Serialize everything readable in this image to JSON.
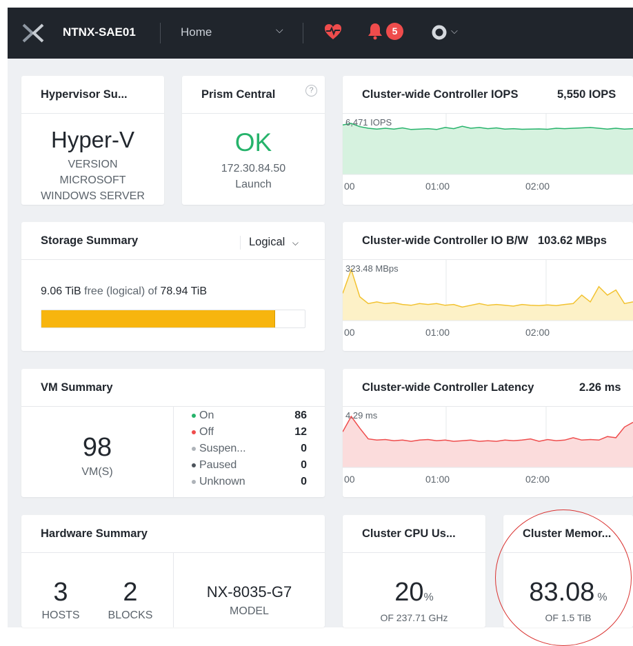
{
  "topbar": {
    "cluster_name": "NTNX-SAE01",
    "view": "Home",
    "alerts_count": "5"
  },
  "hypervisor": {
    "title": "Hypervisor Su...",
    "name": "Hyper-V",
    "version_label": "VERSION",
    "version_line1": "MICROSOFT",
    "version_line2": "WINDOWS SERVER"
  },
  "prism_central": {
    "title": "Prism Central",
    "help": "?",
    "status": "OK",
    "ip": "172.30.84.50",
    "link": "Launch"
  },
  "storage": {
    "title": "Storage Summary",
    "view_select": "Logical",
    "free": "9.06 TiB",
    "free_suffix": " free (logical) of ",
    "total": "78.94 TiB",
    "used_fraction": 0.885
  },
  "vm_summary": {
    "title": "VM Summary",
    "count": "98",
    "count_label": "VM(S)",
    "states": [
      {
        "label": "On",
        "count": "86",
        "color": "#26b36b"
      },
      {
        "label": "Off",
        "count": "12",
        "color": "#ef4c4c"
      },
      {
        "label": "Suspen...",
        "count": "0",
        "color": "#aeb3b9"
      },
      {
        "label": "Paused",
        "count": "0",
        "color": "#4d545c"
      },
      {
        "label": "Unknown",
        "count": "0",
        "color": "#aeb3b9"
      }
    ]
  },
  "hardware": {
    "title": "Hardware Summary",
    "hosts": "3",
    "hosts_label": "HOSTS",
    "blocks": "2",
    "blocks_label": "BLOCKS",
    "model": "NX-8035-G7",
    "model_label": "MODEL"
  },
  "iops": {
    "title": "Cluster-wide Controller IOPS",
    "current": "5,550 IOPS",
    "peak": "6,471 IOPS",
    "ticks": [
      "00",
      "01:00",
      "02:00"
    ],
    "color": "#26b36b",
    "values": [
      6100,
      6300,
      5900,
      5700,
      5600,
      5700,
      5600,
      5750,
      5550,
      5600,
      5650,
      5550,
      5800,
      5650,
      5950,
      5700,
      5800,
      5650,
      5750,
      5600,
      5650,
      5580,
      5600,
      5620,
      5580,
      5700,
      5650,
      5700,
      5750,
      5800,
      5700,
      5600,
      5700,
      5600,
      5650
    ]
  },
  "iobw": {
    "title": "Cluster-wide Controller IO B/W",
    "current": "103.62 MBps",
    "peak": "323.48 MBps",
    "ticks": [
      "00",
      "01:00",
      "02:00"
    ],
    "color": "#f2c230",
    "values": [
      160,
      300,
      140,
      100,
      110,
      100,
      105,
      95,
      90,
      100,
      95,
      100,
      90,
      95,
      80,
      90,
      100,
      90,
      95,
      90,
      85,
      95,
      90,
      88,
      92,
      88,
      95,
      100,
      150,
      110,
      200,
      150,
      180,
      100,
      110
    ]
  },
  "latency": {
    "title": "Cluster-wide Controller Latency",
    "current": "2.26 ms",
    "peak": "4.29 ms",
    "ticks": [
      "00",
      "01:00",
      "02:00"
    ],
    "color": "#ef4c4c",
    "values": [
      3.0,
      4.29,
      3.3,
      2.4,
      2.3,
      2.35,
      2.25,
      2.3,
      2.2,
      2.3,
      2.35,
      2.25,
      2.3,
      2.2,
      2.25,
      2.3,
      2.2,
      2.25,
      2.2,
      2.3,
      2.25,
      2.3,
      2.4,
      2.2,
      2.35,
      2.25,
      2.3,
      2.5,
      2.3,
      2.35,
      2.3,
      2.6,
      2.5,
      3.4,
      3.8
    ]
  },
  "cpu": {
    "title": "Cluster CPU Us...",
    "value": "20",
    "unit": "%",
    "sub": "OF 237.71 GHz"
  },
  "memory": {
    "title": "Cluster Memor...",
    "value": "83.08",
    "unit": "%",
    "sub": "OF 1.5 TiB"
  }
}
